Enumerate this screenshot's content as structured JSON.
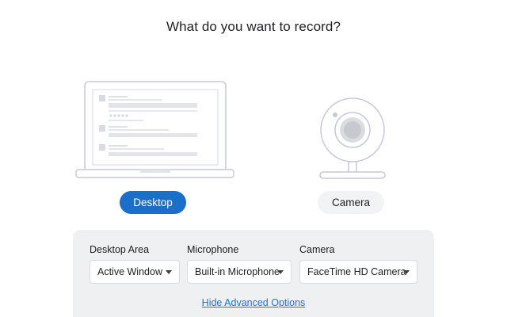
{
  "header": {
    "title": "What do you want to record?"
  },
  "modes": {
    "desktop_label": "Desktop",
    "camera_label": "Camera",
    "selected": "Desktop"
  },
  "options": {
    "desktop_area": {
      "label": "Desktop Area",
      "value": "Active Window"
    },
    "microphone": {
      "label": "Microphone",
      "value": "Built-in Microphone"
    },
    "camera": {
      "label": "Camera",
      "value": "FaceTime HD Camera"
    }
  },
  "advanced": {
    "link_label": "Hide Advanced Options"
  },
  "colors": {
    "accent": "#1b6fc8",
    "link": "#1a73e8",
    "panel_bg": "#eef0f2",
    "illustration_stroke": "#c5c9dc"
  },
  "icons": {
    "desktop_illustration": "laptop-icon",
    "camera_illustration": "webcam-icon",
    "dropdown": "caret-down-icon"
  }
}
